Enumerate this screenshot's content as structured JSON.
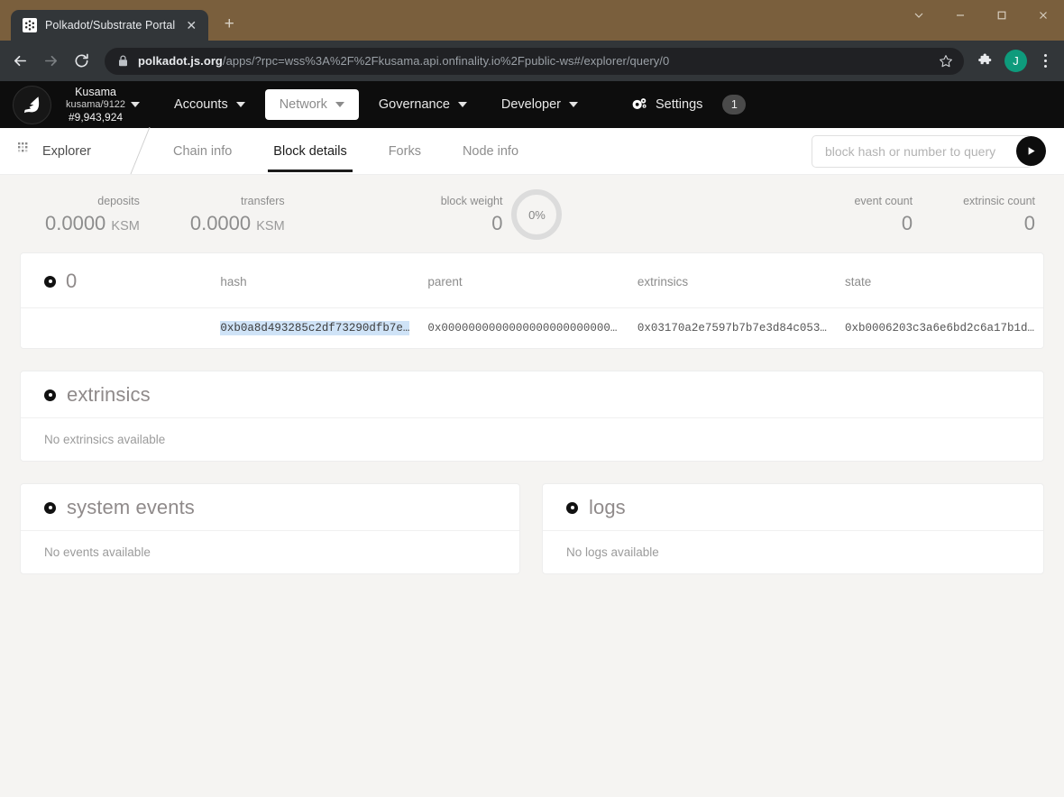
{
  "browser": {
    "tab_title": "Polkadot/Substrate Portal",
    "tab_close_label": "✕",
    "new_tab_label": "+",
    "url_host": "polkadot.js.org",
    "url_path": "/apps/?rpc=wss%3A%2F%2Fkusama.api.onfinality.io%2Fpublic-ws#/explorer/query/0",
    "avatar_initial": "J",
    "window_controls": [
      "chevron-down",
      "minimize",
      "maximize",
      "close"
    ]
  },
  "app_nav": {
    "chain_name": "Kusama",
    "chain_version": "kusama/9122",
    "chain_block": "#9,943,924",
    "items": [
      {
        "label": "Accounts",
        "active": false
      },
      {
        "label": "Network",
        "active": true
      },
      {
        "label": "Governance",
        "active": false
      },
      {
        "label": "Developer",
        "active": false
      }
    ],
    "settings_label": "Settings",
    "settings_badge": "1"
  },
  "tabbar": {
    "breadcrumb": "Explorer",
    "tabs": [
      {
        "label": "Chain info",
        "active": false
      },
      {
        "label": "Block details",
        "active": true
      },
      {
        "label": "Forks",
        "active": false
      },
      {
        "label": "Node info",
        "active": false
      }
    ],
    "query_placeholder": "block hash or number to query",
    "query_value": ""
  },
  "summary": {
    "deposits": {
      "label": "deposits",
      "value": "0.0000",
      "unit": "KSM"
    },
    "transfers": {
      "label": "transfers",
      "value": "0.0000",
      "unit": "KSM"
    },
    "block_weight": {
      "label": "block weight",
      "value": "0",
      "percent": "0%"
    },
    "event_count": {
      "label": "event count",
      "value": "0"
    },
    "extrinsic_count": {
      "label": "extrinsic count",
      "value": "0"
    }
  },
  "block_table": {
    "block_number": "0",
    "headers": [
      "hash",
      "parent",
      "extrinsics",
      "state"
    ],
    "row": {
      "hash": "0xb0a8d493285c2df73290dfb7e…",
      "parent": "0x0000000000000000000000000…",
      "extrinsics": "0x03170a2e7597b7b7e3d84c053…",
      "state": "0xb0006203c3a6e6bd2c6a17b1d…"
    }
  },
  "panels": {
    "extrinsics": {
      "title": "extrinsics",
      "empty": "No extrinsics available"
    },
    "system_events": {
      "title": "system events",
      "empty": "No events available"
    },
    "logs": {
      "title": "logs",
      "empty": "No logs available"
    }
  },
  "colors": {
    "titlebar": "#7a5f3d",
    "browser_chrome": "#323639",
    "app_nav": "#0d0d0d",
    "page_bg": "#f5f4f2",
    "avatar": "#0e9b7c",
    "hash_highlight": "#cfe3f7"
  }
}
